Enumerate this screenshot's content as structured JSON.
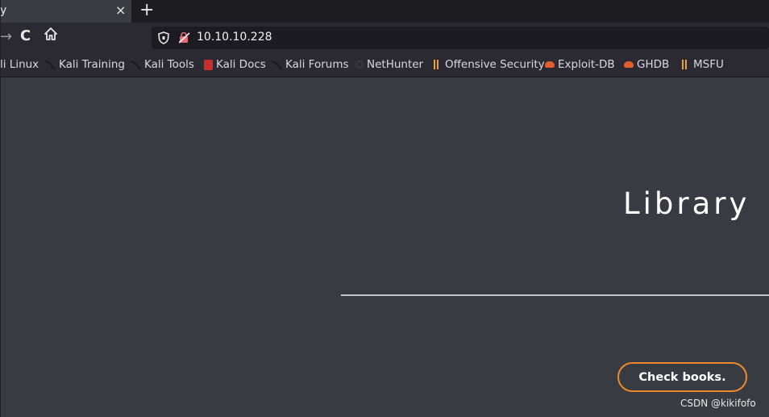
{
  "tab": {
    "title": "y",
    "close": "×",
    "new_tab": "+"
  },
  "nav": {
    "forward_icon": "→",
    "reload_icon": "C",
    "home_icon": "home-icon",
    "url": "10.10.10.228"
  },
  "bookmarks": [
    {
      "label": "li Linux",
      "icon": "kali-icon"
    },
    {
      "label": "Kali Training",
      "icon": "kali-icon"
    },
    {
      "label": "Kali Tools",
      "icon": "kali-icon"
    },
    {
      "label": "Kali Docs",
      "icon": "docs-icon"
    },
    {
      "label": "Kali Forums",
      "icon": "kali-icon"
    },
    {
      "label": "NetHunter",
      "icon": "nethunter-icon"
    },
    {
      "label": "Offensive Security",
      "icon": "offsec-icon"
    },
    {
      "label": "Exploit-DB",
      "icon": "exploit-icon"
    },
    {
      "label": "GHDB",
      "icon": "exploit-icon"
    },
    {
      "label": "MSFU",
      "icon": "offsec-icon"
    }
  ],
  "page": {
    "title": "Library",
    "button": "Check books.",
    "watermark": "CSDN @kikifofo"
  },
  "colors": {
    "page_bg": "#383b41",
    "chrome_bg": "#2b2a33",
    "button_border": "#ee8a2a"
  }
}
